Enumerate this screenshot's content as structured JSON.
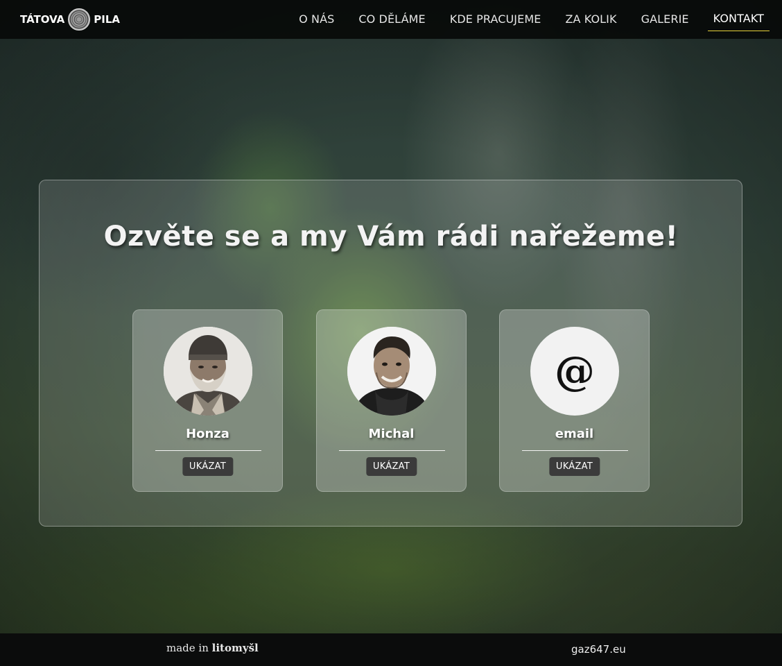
{
  "brand": {
    "left_text": "TÁTOVA",
    "right_text": "PILA",
    "icon": "log-cross-section-icon"
  },
  "nav": {
    "items": [
      {
        "label": "O NÁS"
      },
      {
        "label": "CO DĚLÁME"
      },
      {
        "label": "KDE PRACUJEME"
      },
      {
        "label": "ZA KOLIK"
      },
      {
        "label": "GALERIE"
      },
      {
        "label": "KONTAKT",
        "active": true
      }
    ],
    "active_underline_color": "#e8d33a"
  },
  "contact": {
    "headline": "Ozvěte se a my Vám rádi nařežeme!",
    "cards": [
      {
        "name": "Honza",
        "button": "UKÁZAT",
        "avatar": "person-photo"
      },
      {
        "name": "Michal",
        "button": "UKÁZAT",
        "avatar": "person-photo"
      },
      {
        "name": "email",
        "button": "UKÁZAT",
        "avatar": "at-sign-icon",
        "glyph": "@"
      }
    ]
  },
  "footer": {
    "made_in_prefix": "made in",
    "made_in_place": "litomyšl",
    "link": "gaz647.eu"
  }
}
